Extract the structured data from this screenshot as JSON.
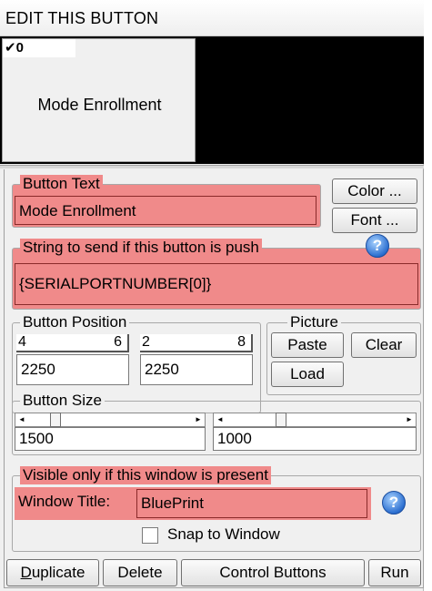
{
  "window": {
    "title": "EDIT THIS BUTTON"
  },
  "preview": {
    "index_label": "0",
    "checked": true,
    "button_text": "Mode Enrollment"
  },
  "button_text": {
    "label": "Button Text",
    "value": "Mode Enrollment"
  },
  "color_button": {
    "label": "Color ..."
  },
  "font_button": {
    "label": "Font ..."
  },
  "string_to_send": {
    "label": "String to send if this button is push",
    "value": "{SERIALPORTNUMBER[0]}"
  },
  "button_position": {
    "label": "Button Position",
    "digits": [
      "4",
      "6",
      "2",
      "8"
    ],
    "x_value": "2250",
    "y_value": "2250"
  },
  "picture": {
    "label": "Picture",
    "paste_label": "Paste",
    "clear_label": "Clear",
    "load_label": "Load"
  },
  "button_size": {
    "label": "Button Size",
    "width_value": "1500",
    "height_value": "1000"
  },
  "visible_only": {
    "label": "Visible only if this window is present",
    "window_title_label": "Window Title:",
    "window_title_value": "BluePrint",
    "snap_label": "Snap to Window",
    "snap_checked": false
  },
  "bottom_buttons": {
    "duplicate": "Duplicate",
    "delete": "Delete",
    "control_buttons": "Control Buttons",
    "run": "Run"
  },
  "icons": {
    "help": "help-icon",
    "check": "check-icon",
    "scroll_left": "arrow-left-icon",
    "scroll_right": "arrow-right-icon"
  },
  "colors": {
    "highlight": "#f08a8a",
    "preview_bg": "#000000",
    "panel_bg": "#f0f0f0"
  }
}
